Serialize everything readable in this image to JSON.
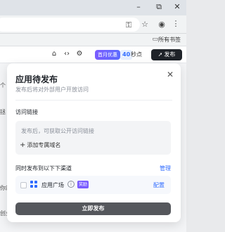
{
  "browser": {
    "window_controls": {
      "minimize": "–",
      "restore": "⧉",
      "close": "✕"
    },
    "toolbar_icons": [
      "key-icon",
      "star-icon",
      "profile-icon",
      "menu-icon"
    ],
    "bookmarks": {
      "all_bookmarks_label": "所有书签"
    }
  },
  "app_toolbar": {
    "deal_badge": "首月优惠",
    "countdown_value": "40",
    "countdown_unit": "秒点",
    "publish_label": "发布"
  },
  "background_fragments": [
    "个",
    "拯",
    "你的",
    "创业"
  ],
  "publish_panel": {
    "title": "应用待发布",
    "subtitle": "发布后将对外部用户开放访问",
    "access_link": {
      "label": "访问链接",
      "placeholder": "发布后，可获取公开访问链接",
      "add_domain": "添加专属域名"
    },
    "channels": {
      "label": "同时发布到以下下渠道",
      "manage": "管理",
      "items": [
        {
          "name": "应用广场",
          "badge": "奖励",
          "action": "配置",
          "checked": false
        }
      ]
    },
    "publish_now": "立即发布"
  },
  "colors": {
    "accent": "#2f6bff",
    "deal_gradient_start": "#7a5cff",
    "publish_button": "#1f2329",
    "publish_now_button": "#55575c"
  }
}
